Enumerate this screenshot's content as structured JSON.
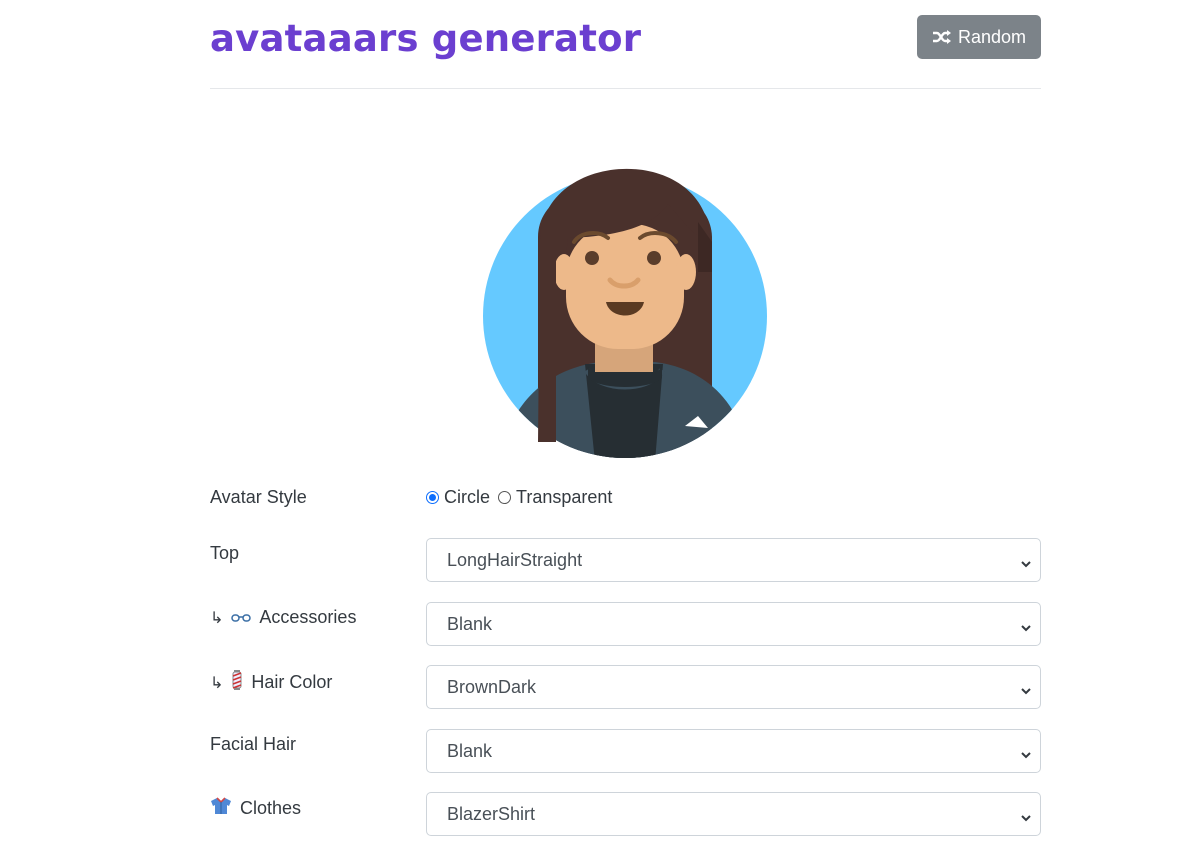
{
  "header": {
    "title": "avataaars generator",
    "random_label": "Random"
  },
  "avatar": {
    "style": "Circle",
    "background_color": "#65C9FF",
    "skin_color": "#EDB98A",
    "hair_color": "#4A312C",
    "clothes_color": "#3C4F5C"
  },
  "form": {
    "avatar_style": {
      "label": "Avatar Style",
      "options": [
        "Circle",
        "Transparent"
      ],
      "selected": "Circle"
    },
    "top": {
      "label": "Top",
      "value": "LongHairStraight"
    },
    "accessories": {
      "prefix": "↳",
      "icon": "glasses-icon",
      "label": "Accessories",
      "value": "Blank"
    },
    "hair_color": {
      "prefix": "↳",
      "icon": "barber-pole-icon",
      "label": "Hair Color",
      "value": "BrownDark"
    },
    "facial_hair": {
      "label": "Facial Hair",
      "value": "Blank"
    },
    "clothes": {
      "icon": "shirt-icon",
      "label": "Clothes",
      "value": "BlazerShirt"
    }
  }
}
